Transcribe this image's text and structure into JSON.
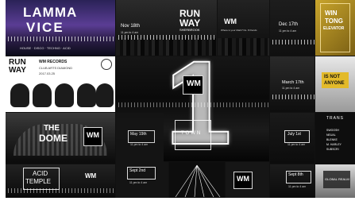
{
  "tiles": {
    "lamma_vice": {
      "title_line1": "LAMMA",
      "title_line2": "VICE",
      "footer": "HOUSE · DISCO · TECHNO · ACID"
    },
    "runway_top": {
      "logo_line1": "RUN",
      "logo_line2": "WAY",
      "tagline": "SHERBROOK"
    },
    "nov18": {
      "date": "Nov 18th",
      "sub": "11 pm to 4 am"
    },
    "wm_mid": {
      "logo": "WM",
      "lines": "Where is your Mark? No. 8 friends"
    },
    "dec17": {
      "date": "Dec 17th",
      "sub": "11 pm to 4 am"
    },
    "yellow": {
      "line1": "WIN",
      "line2": "TONG",
      "line3": "ELEVATOR"
    },
    "runway_records": {
      "logo_line1": "RUN",
      "logo_line2": "WAY",
      "title": "WM RECORDS",
      "sub": "CLUB ARTS DIAMOND",
      "date": "2017.03.25"
    },
    "center": {
      "big_numeral": "1",
      "logo": "WM",
      "town": "TOWN"
    },
    "march": {
      "date": "March 17th",
      "sub": "11 pm to 4 am"
    },
    "not_anyone": {
      "line1": "IS NOT",
      "line2": "ANYONE"
    },
    "dome": {
      "title_line1": "THE",
      "title_line2": "DOME",
      "logo": "WM"
    },
    "may19": {
      "date": "May 19th",
      "sub": "11 pm to 4 am"
    },
    "down_town": {
      "line1": "DOWN",
      "line2": "TOWN"
    },
    "july1": {
      "date": "July 1st",
      "sub": "11 pm to 4 am"
    },
    "list": {
      "header": "TRANS",
      "items": [
        "SWOOSH",
        "NEUAL",
        "BLENKE",
        "M. HARLEY",
        "SUBSCRI"
      ]
    },
    "acid_temple": {
      "line1": "ACID",
      "line2": "TEMPLE",
      "logo": "WM"
    },
    "sept2": {
      "date": "Sept 2nd",
      "sub": "11 pm to 4 am"
    },
    "wm_bottom": {
      "logo": "WM"
    },
    "sept8": {
      "date": "Sept 8th",
      "sub": "11 pm to 4 am"
    },
    "dark_reg": {
      "text": "GLOBAL REALM"
    }
  },
  "colors": {
    "accent_yellow": "#e3ba2a",
    "gold": "#b99a2c",
    "purple_sky": "#4a2f8a",
    "dark": "#111111"
  }
}
